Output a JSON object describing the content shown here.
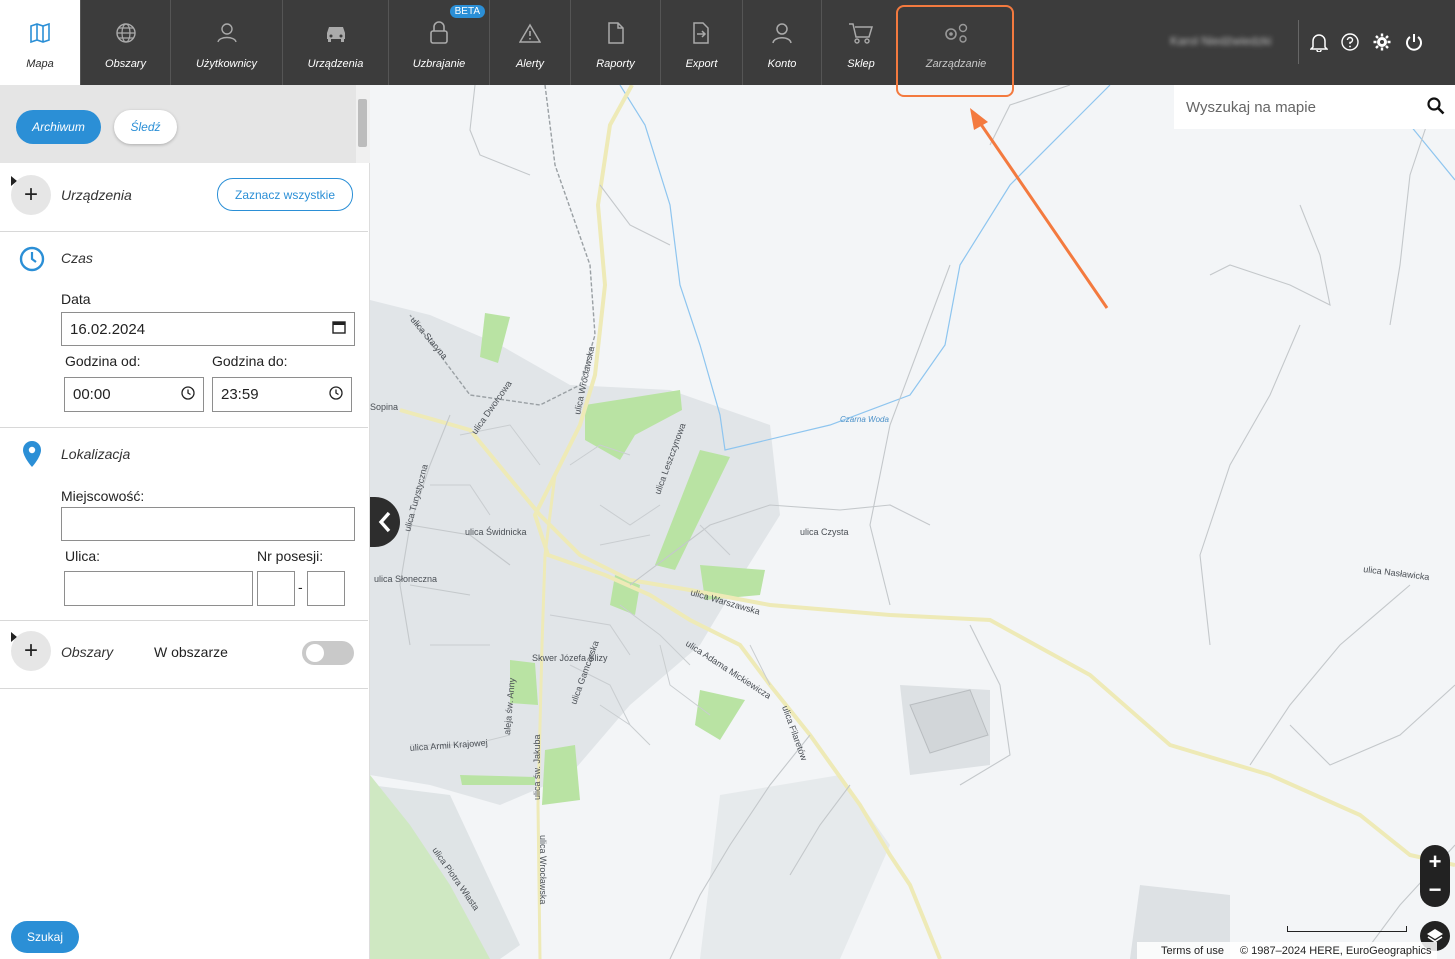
{
  "nav": {
    "items": [
      {
        "label": "Mapa",
        "icon": "map-icon"
      },
      {
        "label": "Obszary",
        "icon": "globe-icon"
      },
      {
        "label": "Użytkownicy",
        "icon": "users-icon"
      },
      {
        "label": "Urządzenia",
        "icon": "car-icon"
      },
      {
        "label": "Uzbrajanie",
        "icon": "lock-icon",
        "badge": "BETA"
      },
      {
        "label": "Alerty",
        "icon": "warning-icon"
      },
      {
        "label": "Raporty",
        "icon": "document-icon"
      },
      {
        "label": "Export",
        "icon": "export-icon"
      },
      {
        "label": "Konto",
        "icon": "user-icon"
      },
      {
        "label": "Sklep",
        "icon": "cart-icon"
      },
      {
        "label": "Zarządzanie",
        "icon": "gears-icon"
      }
    ],
    "user_name": "Karol Niedźwiedzki"
  },
  "sidebar": {
    "mode_archive": "Archiwum",
    "mode_track": "Śledź",
    "devices": {
      "title": "Urządzenia",
      "select_all": "Zaznacz wszystkie"
    },
    "time": {
      "title": "Czas",
      "date_label": "Data",
      "date_value": "16.02.2024",
      "from_label": "Godzina od:",
      "from_value": "00:00",
      "to_label": "Godzina do:",
      "to_value": "23:59"
    },
    "location": {
      "title": "Lokalizacja",
      "city_label": "Miejscowość:",
      "street_label": "Ulica:",
      "number_label": "Nr posesji:",
      "dash": "-"
    },
    "areas": {
      "title": "Obszary",
      "in_area_label": "W obszarze",
      "in_area_enabled": false
    },
    "search_button": "Szukaj"
  },
  "map": {
    "search_placeholder": "Wyszukaj na mapie",
    "zoom_in": "+",
    "zoom_out": "−",
    "terms": "Terms of use",
    "copyright": "© 1987–2024 HERE, EuroGeographics",
    "place_label": "Czarna Woda",
    "streets": [
      "ulica Wrocławska",
      "ulica Świdnicka",
      "ulica Warszawska",
      "ulica Adama Mickiewicza",
      "ulica Czysta",
      "ulica Nasławicka",
      "ulica Słoneczna",
      "ulica Turystyczna",
      "ulica Dworcowa",
      "ulica Leszczynowa",
      "ulica Gamcarska",
      "ulica Armii Krajowej",
      "aleja św. Anny",
      "ulica św. Jakuba",
      "ulica Filaretów",
      "ulica Piotra Własta",
      "ulica Staryna",
      "Skwer Józefa Ślizy",
      "Sopina"
    ]
  },
  "colors": {
    "accent": "#2b8fd6",
    "topbar": "#3c3c3c",
    "highlight": "#f37a3f"
  }
}
